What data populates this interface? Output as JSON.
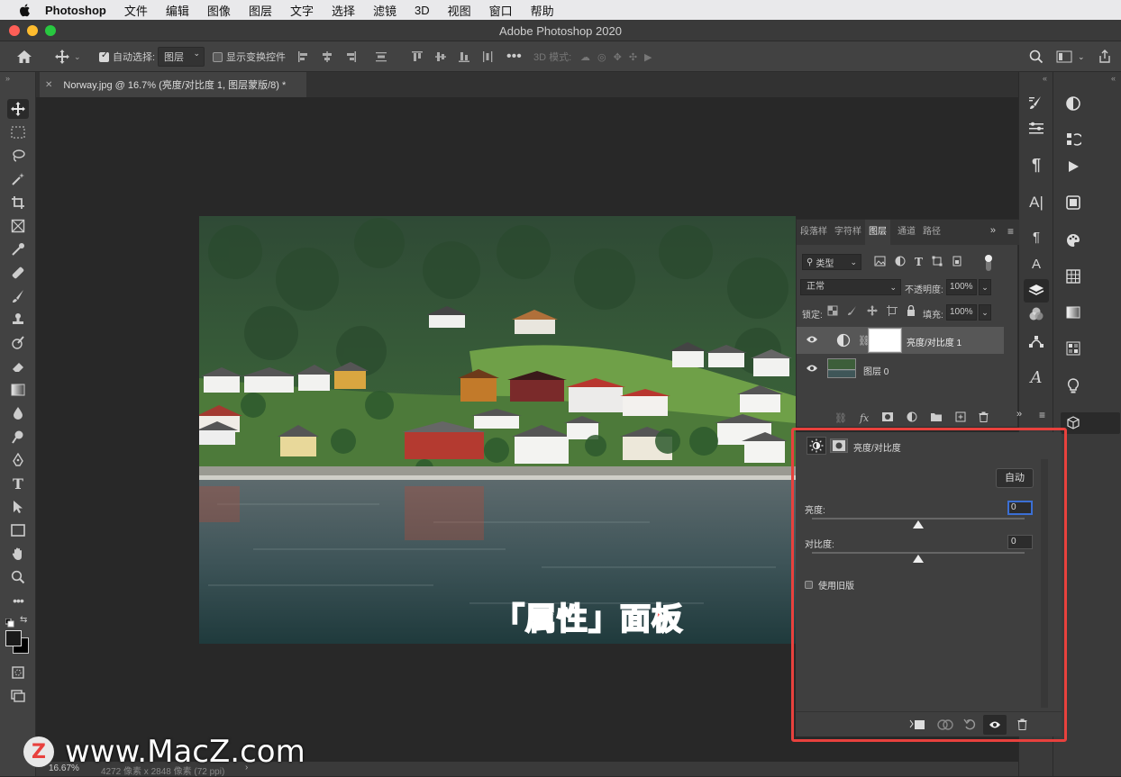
{
  "menubar": {
    "app": "Photoshop",
    "items": [
      "文件",
      "编辑",
      "图像",
      "图层",
      "文字",
      "选择",
      "滤镜",
      "3D",
      "视图",
      "窗口",
      "帮助"
    ]
  },
  "window": {
    "title": "Adobe Photoshop 2020"
  },
  "options": {
    "auto_select_label": "自动选择:",
    "auto_select_value": "图层",
    "show_transform_label": "显示变换控件",
    "mode_3d_label": "3D 模式:"
  },
  "document_tab": {
    "label": "Norway.jpg @ 16.7% (亮度/对比度 1, 图层蒙版/8) *"
  },
  "layers_panel": {
    "tabs": [
      "段落样",
      "字符样",
      "图层",
      "通道",
      "路径"
    ],
    "active_tab": "图层",
    "filter_label": "类型",
    "blend_mode": "正常",
    "opacity_label": "不透明度:",
    "opacity_value": "100%",
    "lock_label": "锁定:",
    "fill_label": "填充:",
    "fill_value": "100%",
    "layers": [
      {
        "name": "亮度/对比度 1",
        "selected": true
      },
      {
        "name": "图层 0",
        "selected": false
      }
    ]
  },
  "properties_panel": {
    "title": "亮度/对比度",
    "auto_button": "自动",
    "brightness_label": "亮度:",
    "brightness_value": "0",
    "contrast_label": "对比度:",
    "contrast_value": "0",
    "legacy_label": "使用旧版"
  },
  "statusbar": {
    "zoom": "16.67%",
    "doc_info": "4272 像素 x 2848 像素 (72 ppi)"
  },
  "annotation": {
    "text": "「属性」面板"
  },
  "watermark": {
    "text": "www.MacZ.com",
    "logo": "Z"
  },
  "colors": {
    "highlight_red": "#e8413d",
    "panel_bg": "#3f3f3f",
    "canvas_bg": "#282828"
  }
}
